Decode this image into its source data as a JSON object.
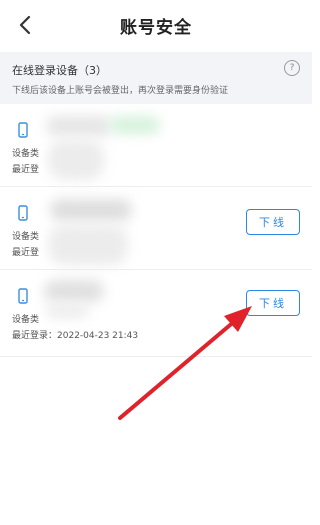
{
  "header": {
    "title": "账号安全"
  },
  "section": {
    "title": "在线登录设备（3）",
    "subtitle": "下线后该设备上账号会被登出，再次登录需要身份验证"
  },
  "devices": [
    {
      "type_label": "设备类",
      "last_login_label": "最近登",
      "last_login_value": "",
      "action": ""
    },
    {
      "type_label": "设备类",
      "last_login_label": "最近登",
      "last_login_value": "",
      "action": "下线"
    },
    {
      "type_label": "设备类",
      "last_login_label": "最近登录：",
      "last_login_value": "2022-04-23 21:43",
      "action": "下线"
    }
  ],
  "colors": {
    "accent": "#2b89e6",
    "arrow": "#e0222b",
    "phone_icon": "#3b8ee0"
  },
  "icons": {
    "back": "chevron-left-icon",
    "help": "question-circle-icon",
    "device": "phone-icon"
  },
  "help_glyph": "?"
}
